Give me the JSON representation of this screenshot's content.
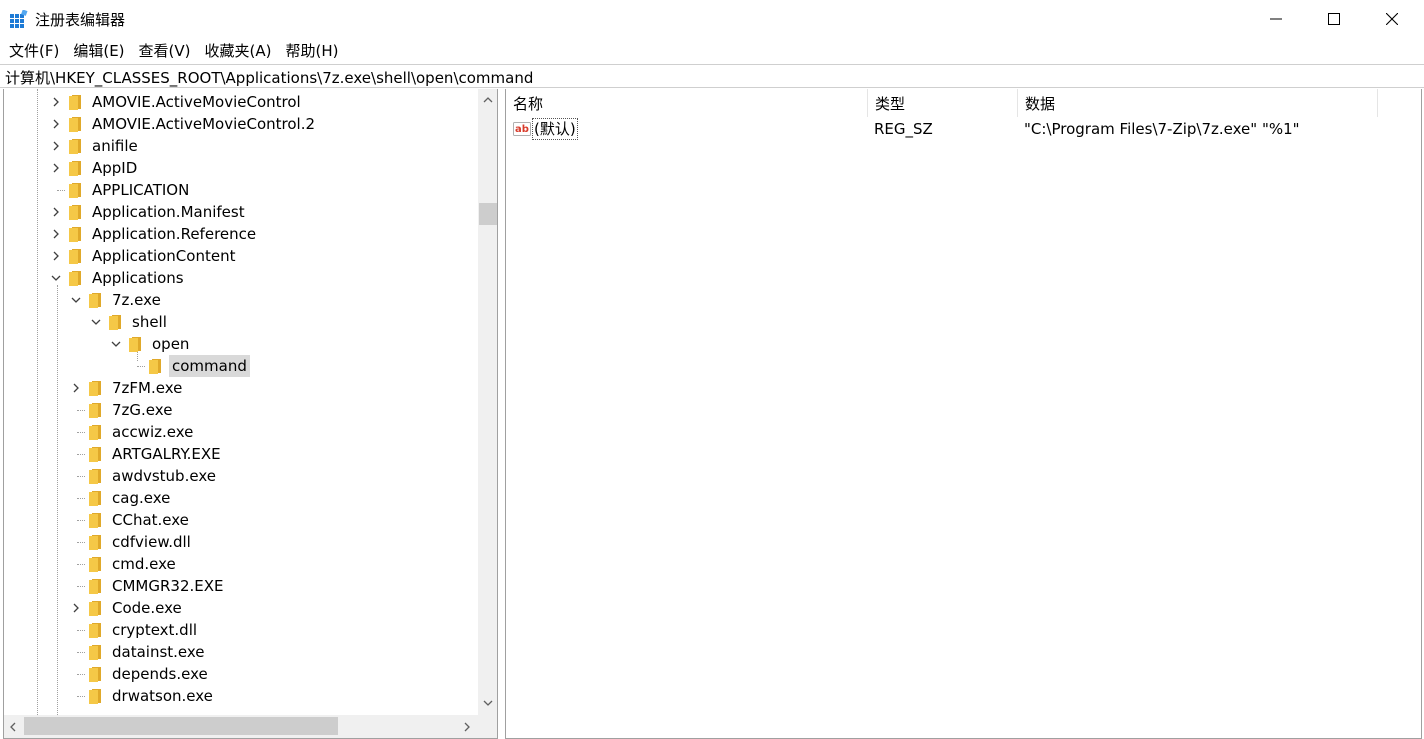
{
  "window": {
    "title": "注册表编辑器",
    "icon": "registry-editor-icon",
    "controls": [
      "minimize-icon",
      "maximize-icon",
      "close-icon"
    ]
  },
  "menu": [
    {
      "label": "文件(F)"
    },
    {
      "label": "编辑(E)"
    },
    {
      "label": "查看(V)"
    },
    {
      "label": "收藏夹(A)"
    },
    {
      "label": "帮助(H)"
    }
  ],
  "address": "计算机\\HKEY_CLASSES_ROOT\\Applications\\7z.exe\\shell\\open\\command",
  "tree": {
    "items": [
      {
        "label": "AMOVIE.ActiveMovieControl",
        "level": 0,
        "expander": "collapsed"
      },
      {
        "label": "AMOVIE.ActiveMovieControl.2",
        "level": 0,
        "expander": "collapsed"
      },
      {
        "label": "anifile",
        "level": 0,
        "expander": "collapsed"
      },
      {
        "label": "AppID",
        "level": 0,
        "expander": "collapsed"
      },
      {
        "label": "APPLICATION",
        "level": 0,
        "expander": "none"
      },
      {
        "label": "Application.Manifest",
        "level": 0,
        "expander": "collapsed"
      },
      {
        "label": "Application.Reference",
        "level": 0,
        "expander": "collapsed"
      },
      {
        "label": "ApplicationContent",
        "level": 0,
        "expander": "collapsed"
      },
      {
        "label": "Applications",
        "level": 0,
        "expander": "expanded"
      },
      {
        "label": "7z.exe",
        "level": 1,
        "expander": "expanded"
      },
      {
        "label": "shell",
        "level": 2,
        "expander": "expanded"
      },
      {
        "label": "open",
        "level": 3,
        "expander": "expanded"
      },
      {
        "label": "command",
        "level": 4,
        "expander": "none",
        "selected": true
      },
      {
        "label": "7zFM.exe",
        "level": 1,
        "expander": "collapsed"
      },
      {
        "label": "7zG.exe",
        "level": 1,
        "expander": "none"
      },
      {
        "label": "accwiz.exe",
        "level": 1,
        "expander": "none"
      },
      {
        "label": "ARTGALRY.EXE",
        "level": 1,
        "expander": "none"
      },
      {
        "label": "awdvstub.exe",
        "level": 1,
        "expander": "none"
      },
      {
        "label": "cag.exe",
        "level": 1,
        "expander": "none"
      },
      {
        "label": "CChat.exe",
        "level": 1,
        "expander": "none"
      },
      {
        "label": "cdfview.dll",
        "level": 1,
        "expander": "none"
      },
      {
        "label": "cmd.exe",
        "level": 1,
        "expander": "none"
      },
      {
        "label": "CMMGR32.EXE",
        "level": 1,
        "expander": "none"
      },
      {
        "label": "Code.exe",
        "level": 1,
        "expander": "collapsed"
      },
      {
        "label": "cryptext.dll",
        "level": 1,
        "expander": "none"
      },
      {
        "label": "datainst.exe",
        "level": 1,
        "expander": "none"
      },
      {
        "label": "depends.exe",
        "level": 1,
        "expander": "none"
      },
      {
        "label": "drwatson.exe",
        "level": 1,
        "expander": "none"
      }
    ]
  },
  "list": {
    "columns": [
      "名称",
      "类型",
      "数据"
    ],
    "rows": [
      {
        "icon": "string-value-icon",
        "name": "(默认)",
        "type": "REG_SZ",
        "data": "\"C:\\Program Files\\7-Zip\\7z.exe\" \"%1\""
      }
    ]
  },
  "colors": {
    "folder": "#f5c847",
    "selection": "#d9d9d9",
    "border": "#a0a0a0",
    "scrollbar": "#f0f0f0"
  }
}
